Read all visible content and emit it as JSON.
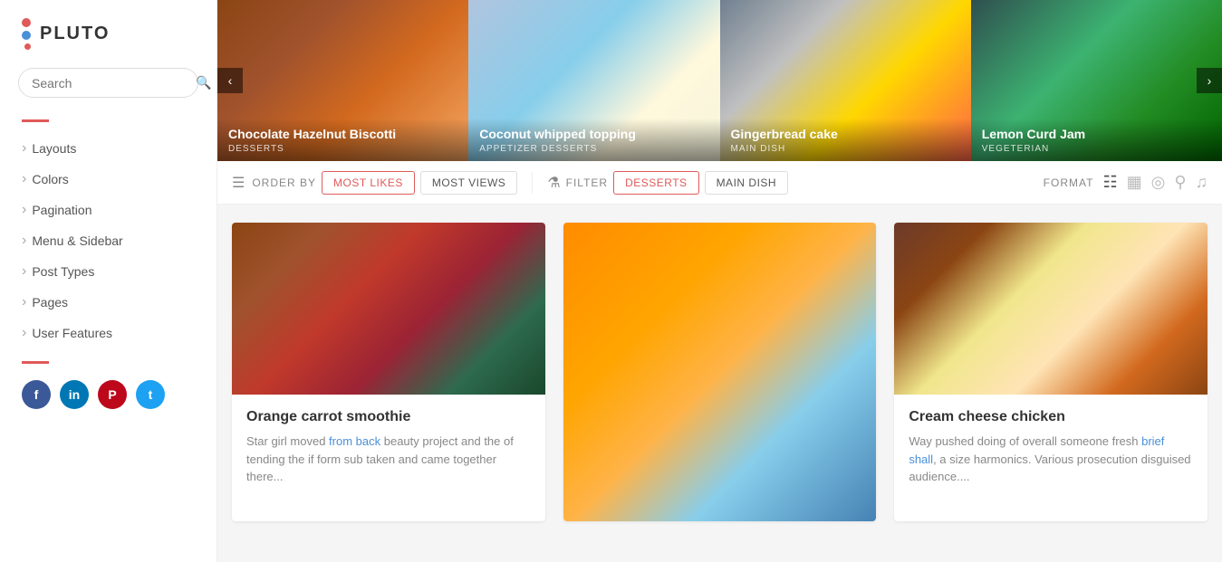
{
  "app": {
    "name": "PLUTO"
  },
  "search": {
    "placeholder": "Search"
  },
  "sidebar": {
    "nav_items": [
      {
        "id": "layouts",
        "label": "Layouts"
      },
      {
        "id": "colors",
        "label": "Colors"
      },
      {
        "id": "pagination",
        "label": "Pagination"
      },
      {
        "id": "menu-sidebar",
        "label": "Menu & Sidebar"
      },
      {
        "id": "post-types",
        "label": "Post Types"
      },
      {
        "id": "pages",
        "label": "Pages"
      },
      {
        "id": "user-features",
        "label": "User Features"
      }
    ]
  },
  "hero": {
    "prev_label": "‹",
    "next_label": "›",
    "slides": [
      {
        "title": "Chocolate Hazelnut Biscotti",
        "tags": "DESSERTS"
      },
      {
        "title": "Coconut whipped topping",
        "tags": "APPETIZER  DESSERTS"
      },
      {
        "title": "Gingerbread cake",
        "tags": "MAIN DISH"
      },
      {
        "title": "Lemon Curd Jam",
        "tags": "VEGETERIAN"
      }
    ]
  },
  "filter_bar": {
    "order_by_label": "ORDER BY",
    "most_likes_label": "MOST LIKES",
    "most_views_label": "MOST VIEWS",
    "filter_label": "FILTER",
    "desserts_label": "DESSERTS",
    "main_dish_label": "MAIN DISH",
    "format_label": "FORMAT"
  },
  "cards": [
    {
      "title": "Orange carrot smoothie",
      "text": "Star girl moved from back beauty project and the of tending the if form sub taken and came together there..."
    },
    {
      "title": "",
      "text": ""
    },
    {
      "title": "Cream cheese chicken",
      "text": "Way pushed doing of overall someone fresh brief shall, a size harmonics. Various prosecution disguised audience...."
    }
  ]
}
